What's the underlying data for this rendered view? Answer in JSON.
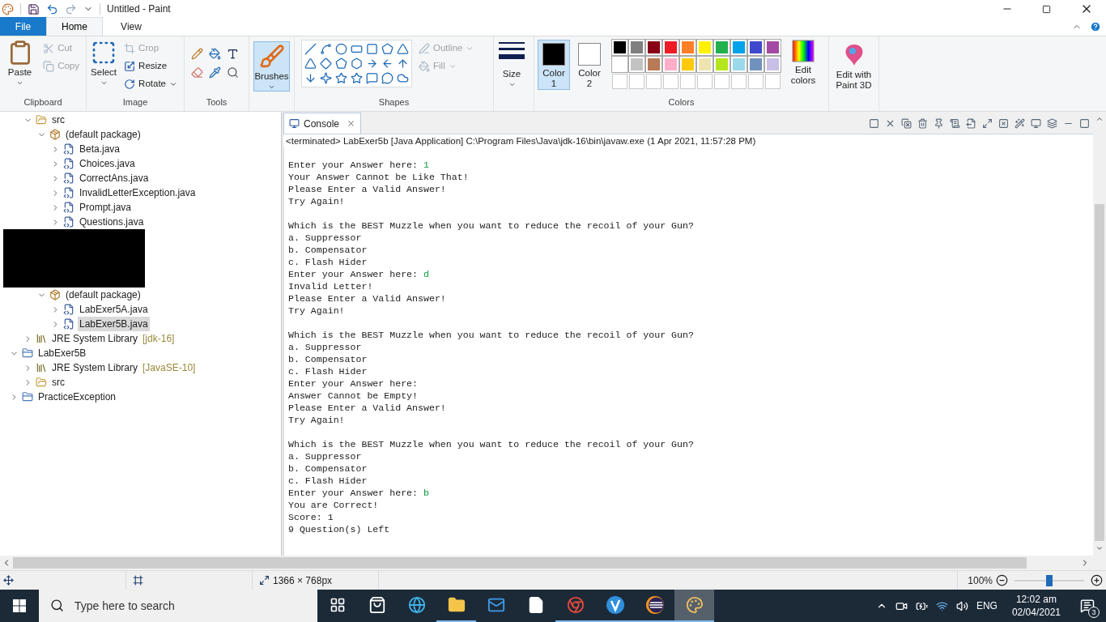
{
  "window": {
    "title": "Untitled - Paint"
  },
  "tabs": [
    {
      "label": "File",
      "kind": "file",
      "selected": false
    },
    {
      "label": "Home",
      "kind": "tab",
      "selected": true
    },
    {
      "label": "View",
      "kind": "tab",
      "selected": false
    }
  ],
  "clipboard": {
    "label": "Clipboard",
    "paste": "Paste",
    "cut": {
      "label": "Cut",
      "disabled": true
    },
    "copy": {
      "label": "Copy",
      "disabled": true
    }
  },
  "image": {
    "label": "Image",
    "select": "Select",
    "crop": {
      "label": "Crop",
      "disabled": true
    },
    "resize": {
      "label": "Resize",
      "disabled": false
    },
    "rotate": {
      "label": "Rotate",
      "disabled": false
    }
  },
  "tools": {
    "label": "Tools"
  },
  "brushes": {
    "label": "Brushes",
    "selected": true
  },
  "shapes": {
    "label": "Shapes",
    "outline": {
      "label": "Outline",
      "disabled": true
    },
    "fill": {
      "label": "Fill",
      "disabled": true
    }
  },
  "size": {
    "label": "Size"
  },
  "colors": {
    "label": "Colors",
    "color1": {
      "label": "Color 1",
      "color": "#000000",
      "selected": true
    },
    "color2": {
      "label": "Color 2",
      "color": "#ffffff",
      "selected": false
    },
    "palette": [
      {
        "kind": "color",
        "color": "#000000"
      },
      {
        "kind": "color",
        "color": "#7f7f7f"
      },
      {
        "kind": "color",
        "color": "#880015"
      },
      {
        "kind": "color",
        "color": "#ed1c24"
      },
      {
        "kind": "color",
        "color": "#ff7f27"
      },
      {
        "kind": "color",
        "color": "#fff200"
      },
      {
        "kind": "color",
        "color": "#22b14c"
      },
      {
        "kind": "color",
        "color": "#00a2e8"
      },
      {
        "kind": "color",
        "color": "#3f48cc"
      },
      {
        "kind": "color",
        "color": "#a349a4"
      },
      {
        "kind": "color",
        "color": "#ffffff"
      },
      {
        "kind": "color",
        "color": "#c3c3c3"
      },
      {
        "kind": "color",
        "color": "#b97a57"
      },
      {
        "kind": "color",
        "color": "#ffaec9"
      },
      {
        "kind": "color",
        "color": "#ffc90e"
      },
      {
        "kind": "color",
        "color": "#efe4b0"
      },
      {
        "kind": "color",
        "color": "#b5e61d"
      },
      {
        "kind": "color",
        "color": "#99d9ea"
      },
      {
        "kind": "color",
        "color": "#7092be"
      },
      {
        "kind": "color",
        "color": "#c8bfe7"
      },
      {
        "kind": "empty"
      },
      {
        "kind": "empty"
      },
      {
        "kind": "empty"
      },
      {
        "kind": "empty"
      },
      {
        "kind": "empty"
      },
      {
        "kind": "empty"
      },
      {
        "kind": "empty"
      },
      {
        "kind": "empty"
      },
      {
        "kind": "empty"
      },
      {
        "kind": "empty"
      }
    ],
    "edit_colors": "Edit colors",
    "paint3d": "Edit with Paint 3D"
  },
  "tree": [
    {
      "kind": "clipped",
      "children": [
        {
          "kind": "source-folder",
          "label": "src",
          "expanded": true,
          "selected": false,
          "children": [
            {
              "kind": "package",
              "label": "(default package)",
              "expanded": true,
              "selected": false,
              "children": [
                {
                  "kind": "java-file",
                  "label": "Beta.java",
                  "expanded": false,
                  "selected": false
                },
                {
                  "kind": "java-file",
                  "label": "Choices.java",
                  "expanded": false,
                  "selected": false
                },
                {
                  "kind": "java-file",
                  "label": "CorrectAns.java",
                  "expanded": false,
                  "selected": false
                },
                {
                  "kind": "java-file",
                  "label": "InvalidLetterException.java",
                  "expanded": false,
                  "selected": false
                },
                {
                  "kind": "java-file",
                  "label": "Prompt.java",
                  "expanded": false,
                  "selected": false
                },
                {
                  "kind": "java-file",
                  "label": "Questions.java",
                  "expanded": false,
                  "selected": false
                }
              ]
            }
          ]
        },
        {
          "kind": "redacted",
          "children": [
            {
              "kind": "package",
              "label": "(default package)",
              "expanded": true,
              "selected": false,
              "children": [
                {
                  "kind": "java-file",
                  "label": "LabExer5A.java",
                  "expanded": false,
                  "selected": false
                },
                {
                  "kind": "java-file",
                  "label": "LabExer5B.java",
                  "expanded": false,
                  "selected": true
                }
              ]
            }
          ]
        },
        {
          "kind": "library",
          "label": "JRE System Library",
          "suffix": "[jdk-16]",
          "expanded": false,
          "selected": false
        }
      ]
    },
    {
      "kind": "project",
      "label": "LabExer5B",
      "expanded": true,
      "selected": false,
      "children": [
        {
          "kind": "library",
          "label": "JRE System Library",
          "suffix": "[JavaSE-10]",
          "expanded": false,
          "selected": false
        },
        {
          "kind": "source-folder",
          "label": "src",
          "expanded": false,
          "selected": false
        }
      ]
    },
    {
      "kind": "project",
      "label": "PracticeException",
      "expanded": false,
      "selected": false
    }
  ],
  "console": {
    "tab": "Console",
    "status": "<terminated> LabExer5b [Java Application] C:\\Program Files\\Java\\jdk-16\\bin\\javaw.exe (1 Apr 2021, 11:57:28 PM)",
    "blocks": [
      {
        "lines": [
          {
            "text": "Enter your Answer here: ",
            "input": "1"
          },
          {
            "text": "Your Answer Cannot be Like That!"
          },
          {
            "text": "Please Enter a Valid Answer!"
          },
          {
            "text": "Try Again!"
          }
        ]
      },
      {
        "lines": [
          {
            "text": "Which is the BEST Muzzle when you want to reduce the recoil of your Gun?"
          },
          {
            "text": "a. Suppressor"
          },
          {
            "text": "b. Compensator"
          },
          {
            "text": "c. Flash Hider"
          },
          {
            "text": "Enter your Answer here: ",
            "input": "d"
          },
          {
            "text": "Invalid Letter!"
          },
          {
            "text": "Please Enter a Valid Answer!"
          },
          {
            "text": "Try Again!"
          }
        ]
      },
      {
        "lines": [
          {
            "text": "Which is the BEST Muzzle when you want to reduce the recoil of your Gun?"
          },
          {
            "text": "a. Suppressor"
          },
          {
            "text": "b. Compensator"
          },
          {
            "text": "c. Flash Hider"
          },
          {
            "text": "Enter your Answer here:"
          },
          {
            "text": "Answer Cannot be Empty!"
          },
          {
            "text": "Please Enter a Valid Answer!"
          },
          {
            "text": "Try Again!"
          }
        ]
      },
      {
        "lines": [
          {
            "text": "Which is the BEST Muzzle when you want to reduce the recoil of your Gun?"
          },
          {
            "text": "a. Suppressor"
          },
          {
            "text": "b. Compensator"
          },
          {
            "text": "c. Flash Hider"
          },
          {
            "text": "Enter your Answer here: ",
            "input": "b"
          },
          {
            "text": "You are Correct!"
          },
          {
            "text": "Score: 1"
          },
          {
            "text": "9 Question(s) Left"
          }
        ]
      }
    ]
  },
  "status_bar": {
    "size": "1366 × 768px",
    "zoom": {
      "reading": "100%",
      "level": 0.5
    }
  },
  "taskbar": {
    "search": {
      "placeholder": "Type here to search"
    },
    "apps": [
      {
        "kind": "task-view",
        "running": false,
        "selected": false
      },
      {
        "kind": "store",
        "running": false,
        "selected": false
      },
      {
        "kind": "edge",
        "running": false,
        "selected": false
      },
      {
        "kind": "explorer",
        "running": true,
        "selected": false
      },
      {
        "kind": "mail",
        "running": false,
        "selected": false
      },
      {
        "kind": "document",
        "running": false,
        "selected": false
      },
      {
        "kind": "chrome",
        "running": true,
        "selected": false
      },
      {
        "kind": "v-app",
        "running": true,
        "selected": false
      },
      {
        "kind": "eclipse",
        "running": true,
        "selected": false
      },
      {
        "kind": "paint",
        "running": true,
        "selected": true
      }
    ],
    "language": "ENG",
    "time": "12:02 am",
    "date": "02/04/2021",
    "notifications": "3"
  }
}
